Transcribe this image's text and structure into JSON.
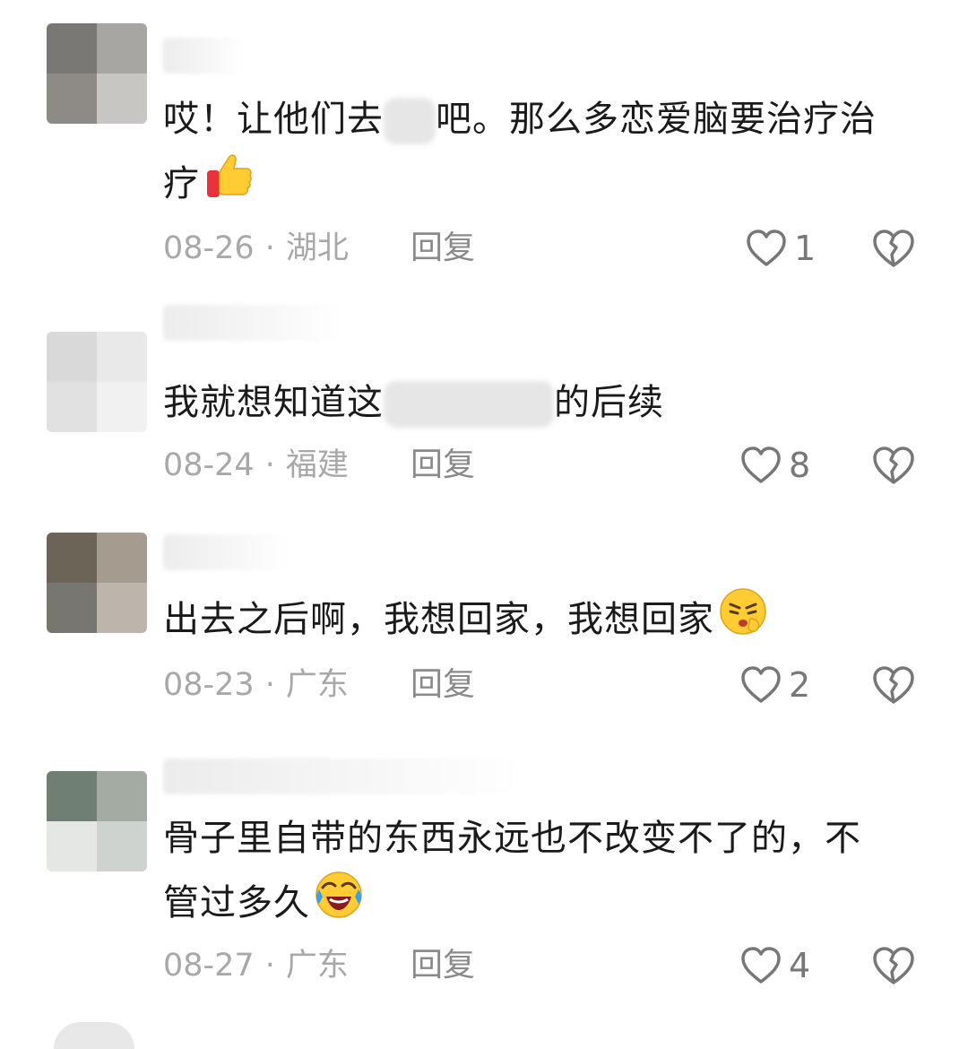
{
  "comments": [
    {
      "text_before": "哎！让他们去",
      "text_after": "吧。那么多恋爱脑要治疗治疗",
      "emoji": "thumbs-up",
      "date": "08-26",
      "location": "湖北",
      "reply_label": "回复",
      "likes": "1",
      "avatar_colors": [
        "#7a7875",
        "#a7a6a2",
        "#8e8b87",
        "#c7c6c2"
      ]
    },
    {
      "text_before": "我就想知道这",
      "text_after": "的后续",
      "emoji": "",
      "date": "08-24",
      "location": "福建",
      "reply_label": "回复",
      "likes": "8",
      "avatar_colors": [
        "#d9d9d9",
        "#e9e9e9",
        "#e1e1e1",
        "#f1f1f1"
      ]
    },
    {
      "text_before": "出去之后啊，我想回家，我想回家",
      "text_after": "",
      "emoji": "thinking-face",
      "date": "08-23",
      "location": "广东",
      "reply_label": "回复",
      "likes": "2",
      "avatar_colors": [
        "#6c6456",
        "#a69b8f",
        "#787670",
        "#bdb5ab"
      ]
    },
    {
      "text_before": "骨子里自带的东西永远也不改变不了的，不管过多久",
      "text_after": "",
      "emoji": "laughing-crying-face",
      "date": "08-27",
      "location": "广东",
      "reply_label": "回复",
      "likes": "4",
      "avatar_colors": [
        "#6f7f74",
        "#a3aba3",
        "#e5e7e5",
        "#cfd3d0"
      ]
    }
  ],
  "separator": "·",
  "icons": {
    "like": "heart-outline-icon",
    "dislike": "broken-heart-icon"
  }
}
